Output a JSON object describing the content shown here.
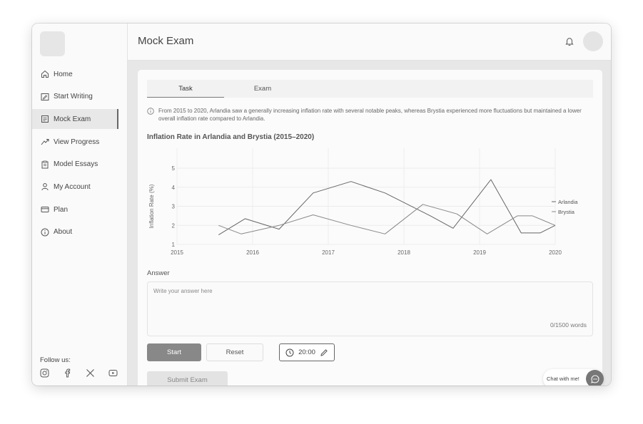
{
  "app": {
    "page_title": "Mock Exam"
  },
  "sidebar": {
    "items": [
      {
        "label": "Home",
        "icon": "home-icon"
      },
      {
        "label": "Start Writing",
        "icon": "edit-icon"
      },
      {
        "label": "Mock Exam",
        "icon": "document-icon",
        "active": true
      },
      {
        "label": "View Progress",
        "icon": "trend-icon"
      },
      {
        "label": "Model Essays",
        "icon": "clipboard-icon"
      },
      {
        "label": "My Account",
        "icon": "user-icon"
      },
      {
        "label": "Plan",
        "icon": "card-icon"
      },
      {
        "label": "About",
        "icon": "info-icon"
      }
    ],
    "follow_label": "Follow us:",
    "social": [
      "instagram-icon",
      "facebook-icon",
      "x-icon",
      "youtube-icon"
    ]
  },
  "tabs": [
    {
      "label": "Task",
      "active": true
    },
    {
      "label": "Exam",
      "active": false
    }
  ],
  "task": {
    "info": "From 2015 to 2020, Arlandia saw a generally increasing inflation rate with several notable peaks, whereas Brystia experienced more fluctuations but maintained a lower overall inflation rate compared to Arlandia."
  },
  "chart_data": {
    "type": "line",
    "title": "Inflation Rate in Arlandia and Brystia (2015–2020)",
    "ylabel": "Inflation Rate (%)",
    "xlabel": "",
    "xlim": [
      2015,
      2020
    ],
    "ylim": [
      1,
      5
    ],
    "x_ticks": [
      "2015",
      "2016",
      "2017",
      "2018",
      "2019",
      "2020"
    ],
    "y_ticks": [
      "1",
      "2",
      "3",
      "4",
      "5"
    ],
    "legend_position": "right",
    "grid": true,
    "series": [
      {
        "name": "Arlandia",
        "color": "#666666",
        "points": [
          [
            2015.55,
            1.5
          ],
          [
            2015.9,
            2.35
          ],
          [
            2016.35,
            1.8
          ],
          [
            2016.8,
            3.7
          ],
          [
            2017.3,
            4.3
          ],
          [
            2017.75,
            3.7
          ],
          [
            2018.35,
            2.5
          ],
          [
            2018.65,
            1.85
          ],
          [
            2019.15,
            4.4
          ],
          [
            2019.55,
            1.6
          ],
          [
            2019.8,
            1.6
          ],
          [
            2020.0,
            2.0
          ]
        ]
      },
      {
        "name": "Brystia",
        "color": "#888888",
        "points": [
          [
            2015.55,
            2.0
          ],
          [
            2015.85,
            1.55
          ],
          [
            2016.35,
            2.0
          ],
          [
            2016.8,
            2.55
          ],
          [
            2017.3,
            2.0
          ],
          [
            2017.75,
            1.55
          ],
          [
            2018.25,
            3.1
          ],
          [
            2018.7,
            2.6
          ],
          [
            2019.1,
            1.55
          ],
          [
            2019.5,
            2.5
          ],
          [
            2019.7,
            2.5
          ],
          [
            2020.0,
            2.0
          ]
        ]
      }
    ]
  },
  "answer": {
    "label": "Answer",
    "placeholder": "Write your answer here",
    "word_count": "0/1500 words"
  },
  "controls": {
    "start": "Start",
    "reset": "Reset",
    "timer": "20:00",
    "submit": "Submit Exam"
  },
  "chat": {
    "label": "Chat with me!"
  }
}
